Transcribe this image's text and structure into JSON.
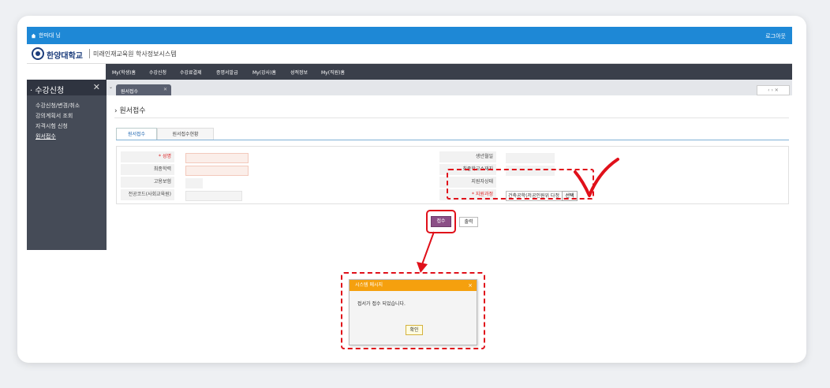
{
  "topbar": {
    "home": "한마대 닝",
    "logout": "로그아웃"
  },
  "header": {
    "university": "한양대학교",
    "system": "미래인재교육원 학사정보시스템"
  },
  "menu": [
    "My(학생)홈",
    "수강신청",
    "수강료결제",
    "증명서발급",
    "My(강사)홈",
    "성적정보",
    "My(직원)홈"
  ],
  "sidebar": {
    "title": "· 수강신청",
    "close": "✕",
    "items": [
      "수강신청/변경/취소",
      "강의계획서 조회",
      "자격시험 신청",
      "원서접수"
    ]
  },
  "tabbar": {
    "active_tab": "원서접수",
    "nav": "‹ › ✕"
  },
  "main": {
    "title": "› 원서접수",
    "subtabs": [
      "원서접수",
      "원서접수현황"
    ],
    "labels": {
      "name": "* 성명",
      "edu": "최종학력",
      "pay": "고용보험",
      "major_code": "전공코드(사회교육원)",
      "birth": "생년월일",
      "school": "최종학교소재지",
      "status": "지원자상태",
      "course": "* 지원과정"
    },
    "course_value": "건축공학(저공인원위 다정",
    "select_button": "선택",
    "apply_button": "접수",
    "print_button": "출력"
  },
  "dialog": {
    "title": "시스템 메시지",
    "close": "×",
    "message": "접서가 접수 되었습니다.",
    "ok": "확인"
  },
  "colors": {
    "accent": "#1e88d6",
    "highlight": "#e0101a",
    "dialog_title": "#f5a00e"
  }
}
